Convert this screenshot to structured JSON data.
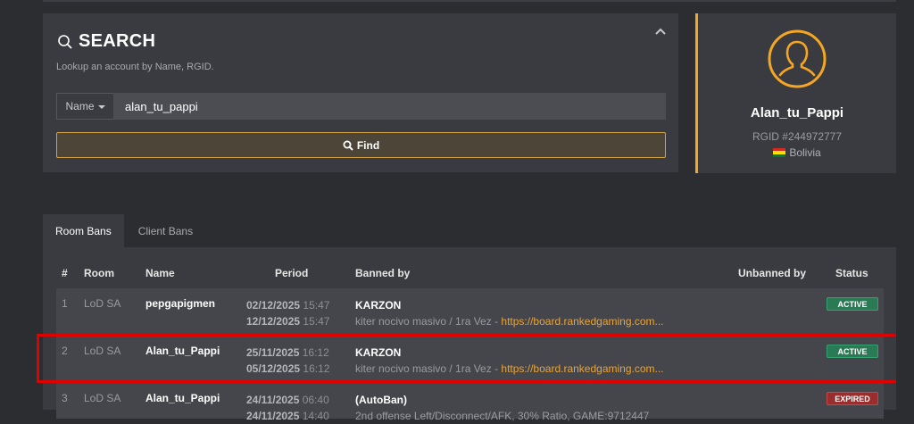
{
  "search": {
    "title": "SEARCH",
    "description": "Lookup an account by Name, RGID.",
    "field_selected": "Name",
    "input_value": "alan_tu_pappi",
    "find_label": "Find"
  },
  "profile": {
    "name": "Alan_tu_Pappi",
    "rgid": "RGID #244972777",
    "country": "Bolivia"
  },
  "tabs": [
    {
      "label": "Room Bans"
    },
    {
      "label": "Client Bans"
    }
  ],
  "table": {
    "headers": {
      "num": "#",
      "room": "Room",
      "name": "Name",
      "period": "Period",
      "banned_by": "Banned by",
      "unbanned_by": "Unbanned by",
      "status": "Status"
    },
    "rows": [
      {
        "num": "1",
        "room": "LoD SA",
        "name": "pepgapigmen",
        "start_date": "02/12/2025",
        "start_time": "15:47",
        "end_date": "12/12/2025",
        "end_time": "15:47",
        "banned_by": "KARZON",
        "reason": "kiter nocivo masivo / 1ra Vez - ",
        "link": "https://board.rankedgaming.com...",
        "status": "ACTIVE"
      },
      {
        "num": "2",
        "room": "LoD SA",
        "name": "Alan_tu_Pappi",
        "start_date": "25/11/2025",
        "start_time": "16:12",
        "end_date": "05/12/2025",
        "end_time": "16:12",
        "banned_by": "KARZON",
        "reason": "kiter nocivo masivo / 1ra Vez - ",
        "link": "https://board.rankedgaming.com...",
        "status": "ACTIVE"
      },
      {
        "num": "3",
        "room": "LoD SA",
        "name": "Alan_tu_Pappi",
        "start_date": "24/11/2025",
        "start_time": "06:40",
        "end_date": "24/11/2025",
        "end_time": "14:40",
        "banned_by": "(AutoBan)",
        "reason": "2nd offense Left/Disconnect/AFK, 30% Ratio, GAME:9712447",
        "status": "EXPIRED"
      }
    ]
  },
  "colors": {
    "accent": "#f5a623",
    "active": "#2a7a56",
    "expired": "#9a2e2e",
    "highlight": "#e00000"
  },
  "icons": [
    "search-icon",
    "chevron-up-icon",
    "caret-down-icon",
    "user-avatar-icon",
    "bolivia-flag-icon"
  ]
}
